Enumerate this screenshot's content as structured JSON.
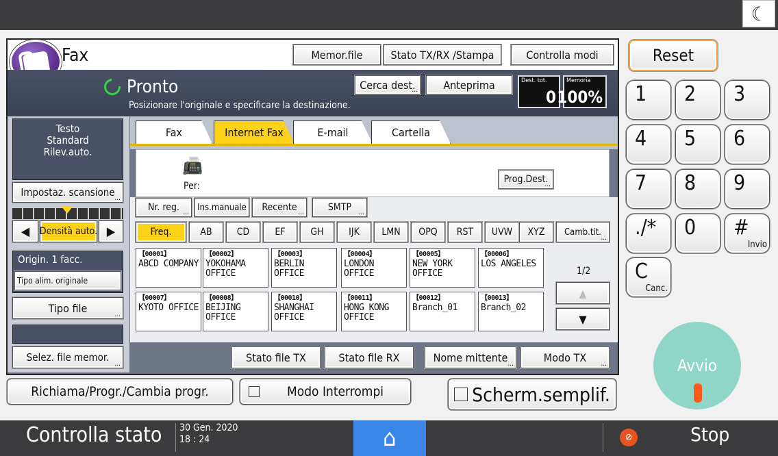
{
  "header": {
    "title": "Fax",
    "night_icon": "moon-icon"
  },
  "top_buttons": {
    "memor_file": "Memor.file",
    "stato": "Stato TX/RX /Stampa",
    "controlla": "Controlla modi"
  },
  "status": {
    "text": "Pronto",
    "hint": "Posizionare l'originale e specificare la destinazione.",
    "cerca": "Cerca dest.",
    "anteprima": "Anteprima",
    "dest_tot_label": "Dest. tot.",
    "dest_tot_value": "0",
    "memoria_label": "Memoria",
    "memoria_value": "100%"
  },
  "left": {
    "info_lines": [
      "Testo",
      "Standard",
      "Rilev.auto."
    ],
    "impostaz": "Impostaz. scansione",
    "densita": "Densità auto.",
    "origin": "Origin. 1 facc.",
    "tipo_alim": "Tipo alim. originale",
    "tipo_file": "Tipo file",
    "selez": "Selez. file memor."
  },
  "tabs": [
    "Fax",
    "Internet Fax",
    "E-mail",
    "Cartella"
  ],
  "dest": {
    "per": "Per:",
    "prog": "Prog.Dest."
  },
  "modes": [
    "Nr. reg.",
    "Ins.manuale",
    "Recente",
    "SMTP"
  ],
  "letters": [
    "Freq.",
    "AB",
    "CD",
    "EF",
    "GH",
    "IJK",
    "LMN",
    "OPQ",
    "RST",
    "UVW",
    "XYZ",
    "Camb.tit."
  ],
  "entries": [
    {
      "code": "【00001】",
      "name": "ABCD COMPANY"
    },
    {
      "code": "【00002】",
      "name": "YOKOHAMA OFFICE"
    },
    {
      "code": "【00003】",
      "name": "BERLIN OFFICE"
    },
    {
      "code": "【00004】",
      "name": "LONDON OFFICE"
    },
    {
      "code": "【00005】",
      "name": "NEW YORK OFFICE"
    },
    {
      "code": "【00006】",
      "name": "LOS ANGELES"
    },
    {
      "code": "【00007】",
      "name": "KYOTO OFFICE"
    },
    {
      "code": "【00008】",
      "name": "BEIJING OFFICE"
    },
    {
      "code": "【00010】",
      "name": "SHANGHAI OFFICE"
    },
    {
      "code": "【00011】",
      "name": "HONG KONG OFFICE"
    },
    {
      "code": "【00012】",
      "name": "Branch_01"
    },
    {
      "code": "【00013】",
      "name": "Branch_02"
    }
  ],
  "page": "1/2",
  "bottom": {
    "stato_tx": "Stato file TX",
    "stato_rx": "Stato file RX",
    "nome": "Nome mittente",
    "modo": "Modo TX"
  },
  "below": {
    "richiama": "Richiama/Progr./Cambia progr.",
    "interrompi": "Modo Interrompi",
    "scherm": "Scherm.semplif."
  },
  "keypad": {
    "reset": "Reset",
    "keys": [
      "1",
      "2",
      "3",
      "4",
      "5",
      "6",
      "7",
      "8",
      "9",
      "./*",
      "0",
      "#"
    ],
    "invio": "Invio",
    "c": "C",
    "canc": "Canc.",
    "avvio": "Avvio"
  },
  "footer": {
    "controlla": "Controlla stato",
    "date": "30 Gen. 2020",
    "time": "18 : 24",
    "stop": "Stop"
  }
}
